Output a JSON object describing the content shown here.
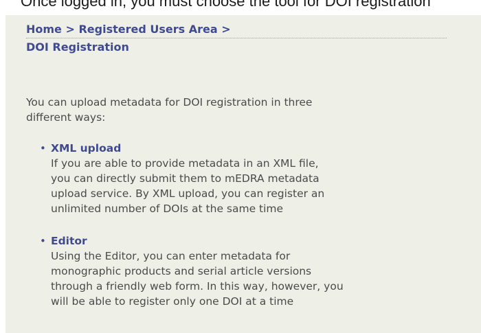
{
  "caption": "Once logged in, you must choose the tool for DOI registration",
  "breadcrumb": {
    "home": "Home",
    "separator": ">",
    "area": "Registered Users Area",
    "trailing_separator": ">"
  },
  "page_title": "DOI Registration",
  "intro_lines": [
    "You can upload metadata for DOI registration in three",
    "different ways:"
  ],
  "options": [
    {
      "title": "XML upload",
      "desc_lines": [
        "If you are able to provide metadata in an XML file,",
        "you can directly submit them to mEDRA metadata",
        "upload service. By XML upload, you can register an",
        "unlimited number of DOIs at the same time"
      ]
    },
    {
      "title": "Editor",
      "desc_lines": [
        "Using the Editor, you can enter metadata for",
        "monographic products and serial article versions",
        "through a friendly web form. In this way, however, you",
        "will be able to register only one DOI at a time"
      ]
    }
  ],
  "colors": {
    "panel_background": "#eef0e8",
    "link": "#404a8f",
    "body_text": "#4a4a4a"
  }
}
